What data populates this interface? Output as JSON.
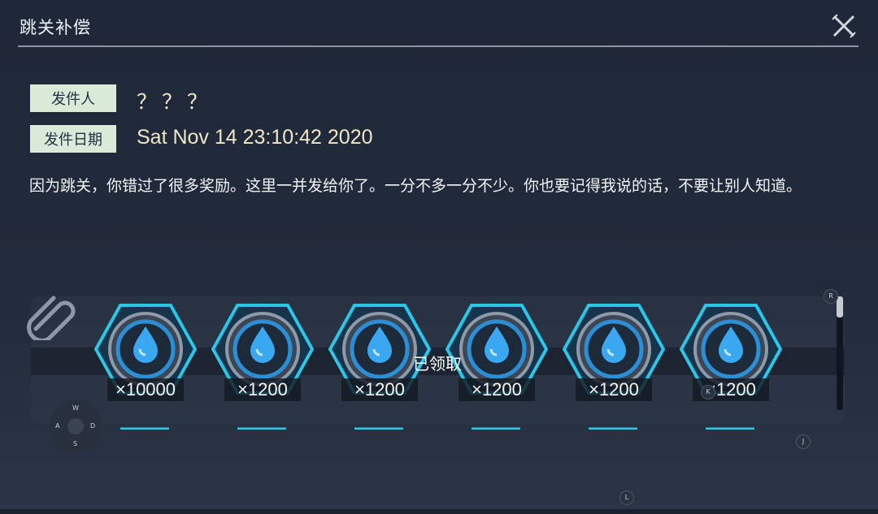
{
  "dialog": {
    "title": "跳关补偿",
    "close_icon": "close-x-icon"
  },
  "mail": {
    "sender_label": "发件人",
    "sender_value": "？？？",
    "date_label": "发件日期",
    "date_value": "Sat Nov 14 23:10:42 2020",
    "message": "因为跳关，你错过了很多奖励。这里一并发给你了。一分不多一分不少。你也要记得我说的话，不要让别人知道。"
  },
  "attachments": {
    "claimed_text": "已领取",
    "items": [
      {
        "icon": "water-drop-coin-icon",
        "quantity": "×10000"
      },
      {
        "icon": "water-drop-coin-icon",
        "quantity": "×1200"
      },
      {
        "icon": "water-drop-coin-icon",
        "quantity": "×1200"
      },
      {
        "icon": "water-drop-coin-icon",
        "quantity": "×1200"
      },
      {
        "icon": "water-drop-coin-icon",
        "quantity": "×1200"
      },
      {
        "icon": "water-drop-coin-icon",
        "quantity": "×1200"
      }
    ]
  },
  "overlay_keys": {
    "r": "R",
    "k": "K",
    "j": "J",
    "l": "L",
    "w": "W",
    "a": "A",
    "s": "S",
    "d": "D"
  },
  "colors": {
    "label_bg": "#d9ead9",
    "value_text": "#f0e6c8",
    "hex_border": "#2cc6e8",
    "drop_blue": "#3aa8f0"
  }
}
